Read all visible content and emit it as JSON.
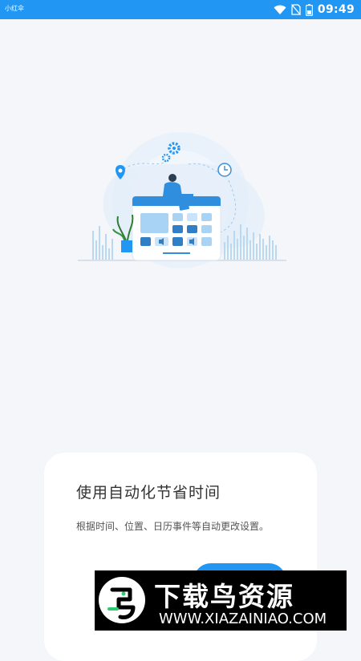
{
  "status_bar": {
    "app_name": "小红伞",
    "time": "09:49",
    "background_color": "#2196f3",
    "icons": [
      "wifi-icon",
      "no-sim-icon",
      "battery-icon"
    ]
  },
  "illustration": {
    "icon": "calendar-automation-illustration"
  },
  "card": {
    "title": "使用自动化节省时间",
    "description": "根据时间、位置、日历事件等自动更改设置。"
  },
  "watermark": {
    "title": "下载鸟资源",
    "url": "WWW.XIAZAINIAO.COM"
  },
  "colors": {
    "accent": "#2196f3",
    "background": "#f4f6f9",
    "card": "#ffffff"
  }
}
